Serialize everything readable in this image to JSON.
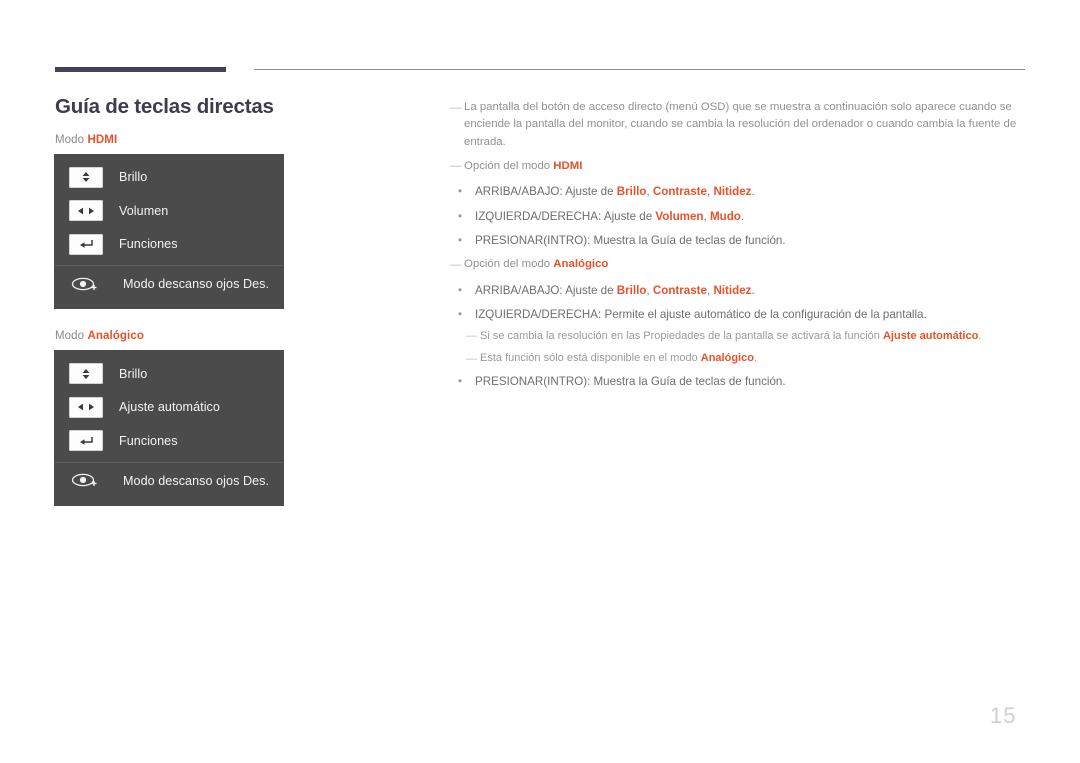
{
  "page": {
    "title": "Guía de teclas directas",
    "number": "15",
    "accent_color": "#e8522a",
    "title_color": "#3f3a4e",
    "osd_bg_color": "#4b4b4b"
  },
  "left": {
    "hdmi": {
      "mode_prefix": "Modo",
      "mode_value": "HDMI",
      "rows": [
        {
          "icon": "updown-arrows-icon",
          "label": "Brillo"
        },
        {
          "icon": "leftright-arrows-icon",
          "label": "Volumen"
        },
        {
          "icon": "enter-arrow-icon",
          "label": "Funciones"
        },
        {
          "icon": "eye-plus-icon",
          "label": "Modo descanso ojos Des."
        }
      ]
    },
    "analog": {
      "mode_prefix": "Modo",
      "mode_value": "Analógico",
      "rows": [
        {
          "icon": "updown-arrows-icon",
          "label": "Brillo"
        },
        {
          "icon": "leftright-arrows-icon",
          "label": "Ajuste automático"
        },
        {
          "icon": "enter-arrow-icon",
          "label": "Funciones"
        },
        {
          "icon": "eye-plus-icon",
          "label": "Modo descanso ojos Des."
        }
      ]
    }
  },
  "right": {
    "intro_note": "La pantalla del botón de acceso directo (menú OSD) que se muestra a continuación solo aparece cuando se enciende la pantalla del monitor, cuando se cambia la resolución del ordenador o cuando cambia la fuente de entrada.",
    "hdmi_section": {
      "heading_prefix": "Opción del modo",
      "heading_value": "HDMI",
      "bullets": [
        {
          "prefix": "ARRIBA/ABAJO: Ajuste de ",
          "h1": "Brillo",
          "sep1": ", ",
          "h2": "Contraste",
          "sep2": ", ",
          "h3": "Nitidez",
          "suffix": "."
        },
        {
          "prefix": "IZQUIERDA/DERECHA: Ajuste de ",
          "h1": "Volumen",
          "sep1": ", ",
          "h2": "Mudo",
          "suffix": "."
        },
        {
          "prefix": "PRESIONAR(INTRO): Muestra la Guía de teclas de función.",
          "suffix": ""
        }
      ]
    },
    "analog_section": {
      "heading_prefix": "Opción del modo",
      "heading_value": "Analógico",
      "bullet1": {
        "prefix": "ARRIBA/ABAJO: Ajuste de ",
        "h1": "Brillo",
        "sep1": ", ",
        "h2": "Contraste",
        "sep2": ", ",
        "h3": "Nitidez",
        "suffix": "."
      },
      "bullet2": "IZQUIERDA/DERECHA: Permite el ajuste automático de la configuración de la pantalla.",
      "subnote1": {
        "prefix": "Si se cambia la resolución en las Propiedades de la pantalla se activará la función ",
        "h1": "Ajuste automático",
        "suffix": "."
      },
      "subnote2": {
        "prefix": "Esta función sólo está disponible en el modo ",
        "h1": "Analógico",
        "suffix": "."
      },
      "bullet3": "PRESIONAR(INTRO): Muestra la Guía de teclas de función."
    }
  }
}
